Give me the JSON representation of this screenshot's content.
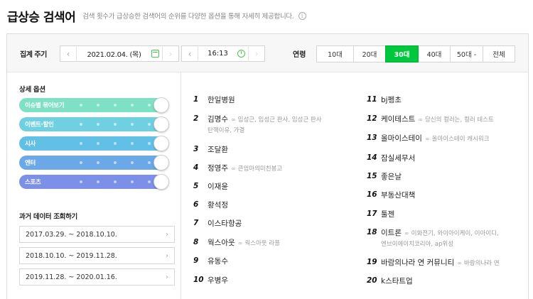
{
  "header": {
    "title": "급상승 검색어",
    "description": "검색 횟수가 급상승한 검색어의 순위를 다양한 옵션을 통해 자세히 제공합니다.",
    "info_icon": "i"
  },
  "filters": {
    "period_label": "집계 주기",
    "date": "2021.02.04. (목)",
    "time": "16:13",
    "age_label": "연령",
    "age_options": [
      "10대",
      "20대",
      "30대",
      "40대",
      "50대 -",
      "전체"
    ],
    "age_selected": "30대",
    "accent_color": "#00c73c"
  },
  "sidebar": {
    "options_title": "상세 옵션",
    "sliders": [
      {
        "label": "이슈별 묶어보기",
        "color": "#7ee0c4"
      },
      {
        "label": "이벤트·할인",
        "color": "#6fd0e2"
      },
      {
        "label": "시사",
        "color": "#62bfe6"
      },
      {
        "label": "엔터",
        "color": "#6aa8e8"
      },
      {
        "label": "스포츠",
        "color": "#7b90e6"
      }
    ],
    "history_title": "과거 데이터 조회하기",
    "history": [
      "2017.03.29. ~ 2018.10.10.",
      "2018.10.10. ~ 2019.11.28.",
      "2019.11.28. ~ 2020.01.16."
    ]
  },
  "ranking": {
    "left": [
      {
        "rank": "1",
        "keyword": "한일병원",
        "related": ""
      },
      {
        "rank": "2",
        "keyword": "김명수",
        "related": "임성근, 임성근 판사, 임성근 판사",
        "related2": "탄핵이유, 가결"
      },
      {
        "rank": "3",
        "keyword": "조달환",
        "related": ""
      },
      {
        "rank": "4",
        "keyword": "정영주",
        "related": "큰엄마의미친봉고"
      },
      {
        "rank": "5",
        "keyword": "이재윤",
        "related": ""
      },
      {
        "rank": "6",
        "keyword": "황석정",
        "related": ""
      },
      {
        "rank": "7",
        "keyword": "이스타항공",
        "related": ""
      },
      {
        "rank": "8",
        "keyword": "웍스아웃",
        "related": "웍스아웃 라플"
      },
      {
        "rank": "9",
        "keyword": "유동수",
        "related": ""
      },
      {
        "rank": "10",
        "keyword": "우병우",
        "related": ""
      }
    ],
    "right": [
      {
        "rank": "11",
        "keyword": "bj펭초",
        "related": ""
      },
      {
        "rank": "12",
        "keyword": "케이테스트",
        "related": "당신의 컬러는, 컬러 테스트"
      },
      {
        "rank": "13",
        "keyword": "올마이스테이",
        "related": "올마이스테이 캐시워크"
      },
      {
        "rank": "14",
        "keyword": "잠실세무서",
        "related": ""
      },
      {
        "rank": "15",
        "keyword": "좋은날",
        "related": ""
      },
      {
        "rank": "16",
        "keyword": "부동산대책",
        "related": ""
      },
      {
        "rank": "17",
        "keyword": "툴젠",
        "related": ""
      },
      {
        "rank": "18",
        "keyword": "이트론",
        "related": "이화전기, 와이아이케이, 이아이디,",
        "related2": "엔브이에이치코리아, ap위성"
      },
      {
        "rank": "19",
        "keyword": "바람의나라 연 커뮤니티",
        "related": "바람의나라 연"
      },
      {
        "rank": "20",
        "keyword": "k스타트업",
        "related": ""
      }
    ]
  }
}
